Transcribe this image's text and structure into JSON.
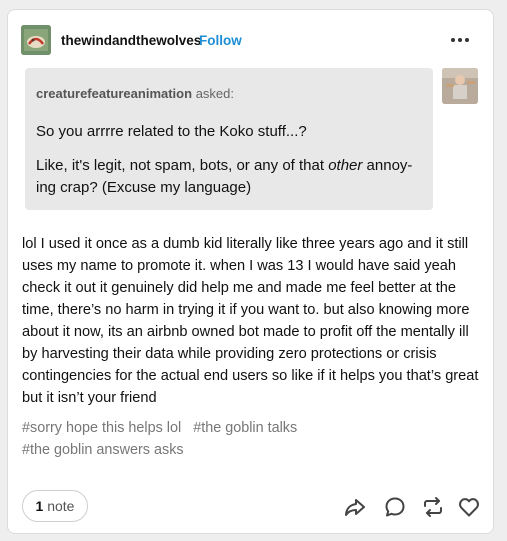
{
  "post": {
    "username": "thewindandthewolves",
    "follow_label": "Follow",
    "more_label": "More options",
    "ask": {
      "asker": "creaturefeatureanimation",
      "asked_label": "asked:",
      "question_line1": "So you arrrre related to the Koko stuff...?",
      "question_line2_before": "Like, it's legit, not spam, bots, or any of that ",
      "question_line2_emph": "other",
      "question_line2_after": " annoy-ing crap? (Excuse my language)"
    },
    "answer": "lol I used it once as a dumb kid literally like three years ago and it still uses my name to promote it. when I was 13 I would have said yeah check it out it genuinely did help me and made me feel better at the time, there’s no harm in trying it if you want to. but also knowing more about it now, its an airbnb owned bot made to profit off the mentally ill by harvesting their data while providing zero protections or crisis contingencies for the actual end users so like if it helps you that’s great but it isn’t your friend",
    "tags": [
      "#sorry hope this helps lol",
      "#the goblin talks",
      "#the goblin answers asks"
    ],
    "notes_count": "1",
    "notes_label": "note",
    "actions": [
      "share-icon",
      "reply-icon",
      "reblog-icon",
      "like-icon"
    ]
  },
  "colors": {
    "accent": "#1e8ed6",
    "ask_background": "#e8e8e8",
    "tag_text": "#777777"
  }
}
